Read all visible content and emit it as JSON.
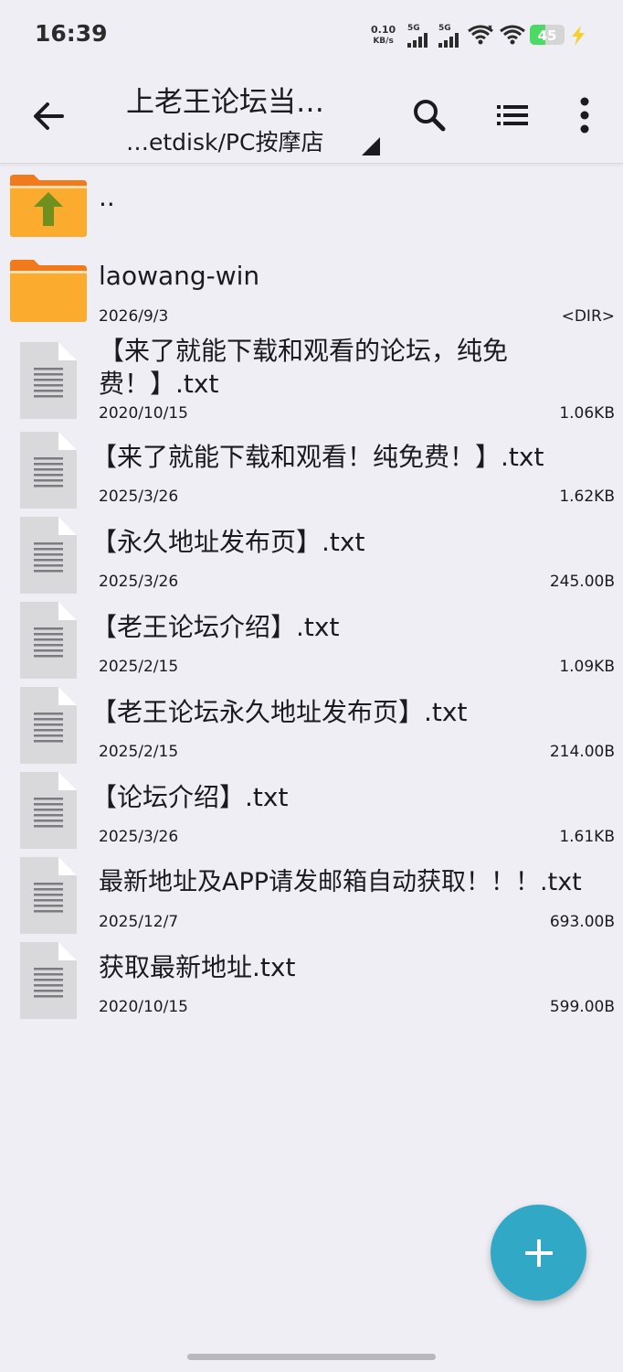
{
  "status_bar": {
    "time": "16:39",
    "net_speed_value": "0.10",
    "net_speed_unit": "KB/s",
    "sim1_label": "5G",
    "sim2_label": "5G",
    "battery_percent": "45",
    "battery_level": 0.45
  },
  "toolbar": {
    "title": "上老王论坛当…",
    "path": "…etdisk/PC按摩店"
  },
  "files": [
    {
      "name": "..",
      "date": "",
      "size": "",
      "type": "parent"
    },
    {
      "name": "laowang-win",
      "date": "2026/9/3",
      "size": "<DIR>",
      "type": "folder"
    },
    {
      "name": "【来了就能下载和观看的论坛，纯免费！】.txt",
      "name_line1": "【来了就能下载和观看的论坛，纯免",
      "name_line2": "费！】.txt",
      "date": "2020/10/15",
      "size": "1.06KB",
      "type": "file"
    },
    {
      "name": "【来了就能下载和观看！纯免费！】.txt",
      "date": "2025/3/26",
      "size": "1.62KB",
      "type": "file"
    },
    {
      "name": "【永久地址发布页】.txt",
      "date": "2025/3/26",
      "size": "245.00B",
      "type": "file"
    },
    {
      "name": "【老王论坛介绍】.txt",
      "date": "2025/2/15",
      "size": "1.09KB",
      "type": "file"
    },
    {
      "name": "【老王论坛永久地址发布页】.txt",
      "date": "2025/2/15",
      "size": "214.00B",
      "type": "file"
    },
    {
      "name": "【论坛介绍】.txt",
      "date": "2025/3/26",
      "size": "1.61KB",
      "type": "file"
    },
    {
      "name": "最新地址及APP请发邮箱自动获取！！！.txt",
      "date": "2025/12/7",
      "size": "693.00B",
      "type": "file"
    },
    {
      "name": "获取最新地址.txt",
      "date": "2020/10/15",
      "size": "599.00B",
      "type": "file"
    }
  ],
  "icons": {
    "back": "arrow-left-icon",
    "search": "search-icon",
    "view": "list-view-icon",
    "more": "more-vertical-icon",
    "fab": "plus-icon"
  },
  "colors": {
    "folder": "#fbab2d",
    "folder_tab": "#f07a1c",
    "up_arrow": "#6f8f1f",
    "fab": "#31a9c6",
    "background": "#efeef4"
  }
}
